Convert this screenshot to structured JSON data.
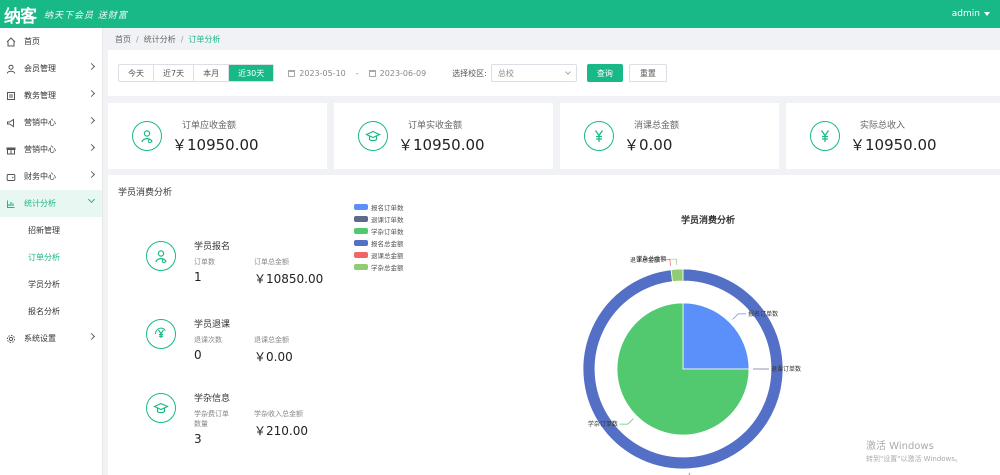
{
  "header": {
    "logo": "纳客",
    "slogan": "纳天下会员 送财富",
    "user": "admin"
  },
  "sidebar": {
    "items": [
      {
        "label": "首页",
        "icon": "home-icon"
      },
      {
        "label": "会员管理",
        "icon": "user-icon"
      },
      {
        "label": "教务管理",
        "icon": "book-icon"
      },
      {
        "label": "营销中心",
        "icon": "megaphone-icon"
      },
      {
        "label": "营销中心",
        "icon": "gift-icon"
      },
      {
        "label": "财务中心",
        "icon": "wallet-icon"
      },
      {
        "label": "统计分析",
        "icon": "chart-icon"
      }
    ],
    "sub_items": [
      {
        "label": "招新管理"
      },
      {
        "label": "订单分析"
      },
      {
        "label": "学员分析"
      },
      {
        "label": "报名分析"
      }
    ],
    "last_item": {
      "label": "系统设置",
      "icon": "gear-icon"
    }
  },
  "breadcrumb": {
    "home": "首页",
    "parent": "统计分析",
    "current": "订单分析"
  },
  "filter": {
    "ranges": [
      "今天",
      "近7天",
      "本月",
      "近30天"
    ],
    "active_range": "近30天",
    "start_date": "2023-05-10",
    "end_date": "2023-06-09",
    "range_sep": "-",
    "select_label": "选择校区:",
    "select_value": "总校",
    "query_button": "查询",
    "reset_button": "重置"
  },
  "cards": [
    {
      "title": "订单应收金额",
      "value": "￥10950.00",
      "icon": "user-refresh-icon"
    },
    {
      "title": "订单实收金额",
      "value": "￥10950.00",
      "icon": "graduation-cap-icon"
    },
    {
      "title": "消课总金额",
      "value": "￥0.00",
      "icon": "yen-icon"
    },
    {
      "title": "实际总收入",
      "value": "￥10950.00",
      "icon": "yen-icon"
    }
  ],
  "panel": {
    "title": "学员消费分析",
    "rows": [
      {
        "title": "学员报名",
        "icon": "user-refresh-icon",
        "col1_label": "订单数",
        "col1_value": "1",
        "col2_label": "订单总金额",
        "col2_value": "￥10850.00"
      },
      {
        "title": "学员退课",
        "icon": "yen-refresh-icon",
        "col1_label": "退课次数",
        "col1_value": "0",
        "col2_label": "退课总金额",
        "col2_value": "￥0.00"
      },
      {
        "title": "学杂信息",
        "icon": "graduation-cap-icon",
        "col1_label": "学杂费订单数量",
        "col1_value": "3",
        "col2_label": "学杂收入总金额",
        "col2_value": "￥210.00"
      }
    ]
  },
  "chart_data": {
    "type": "pie",
    "title": "学员消费分析",
    "legend": [
      {
        "name": "报名订单数",
        "color": "#5b8ff9"
      },
      {
        "name": "退课订单数",
        "color": "#5d6b8a"
      },
      {
        "name": "学杂订单数",
        "color": "#52c86f"
      },
      {
        "name": "报名总金额",
        "color": "#5470c6"
      },
      {
        "name": "退课总金额",
        "color": "#ee6666"
      },
      {
        "name": "学杂总金额",
        "color": "#91cc75"
      }
    ],
    "inner": [
      {
        "name": "报名订单数",
        "value": 1,
        "color": "#5b8ff9"
      },
      {
        "name": "退课订单数",
        "value": 0,
        "color": "#5d6b8a"
      },
      {
        "name": "学杂订单数",
        "value": 3,
        "color": "#52c86f"
      }
    ],
    "outer": [
      {
        "name": "报名总金额",
        "value": 10850,
        "color": "#5470c6"
      },
      {
        "name": "退课总金额",
        "value": 0,
        "color": "#ee6666"
      },
      {
        "name": "学杂总金额",
        "value": 210,
        "color": "#91cc75"
      }
    ],
    "legend_placement": "left"
  },
  "watermark": {
    "line1": "激活 Windows",
    "line2": "转到\"设置\"以激活 Windows。"
  }
}
